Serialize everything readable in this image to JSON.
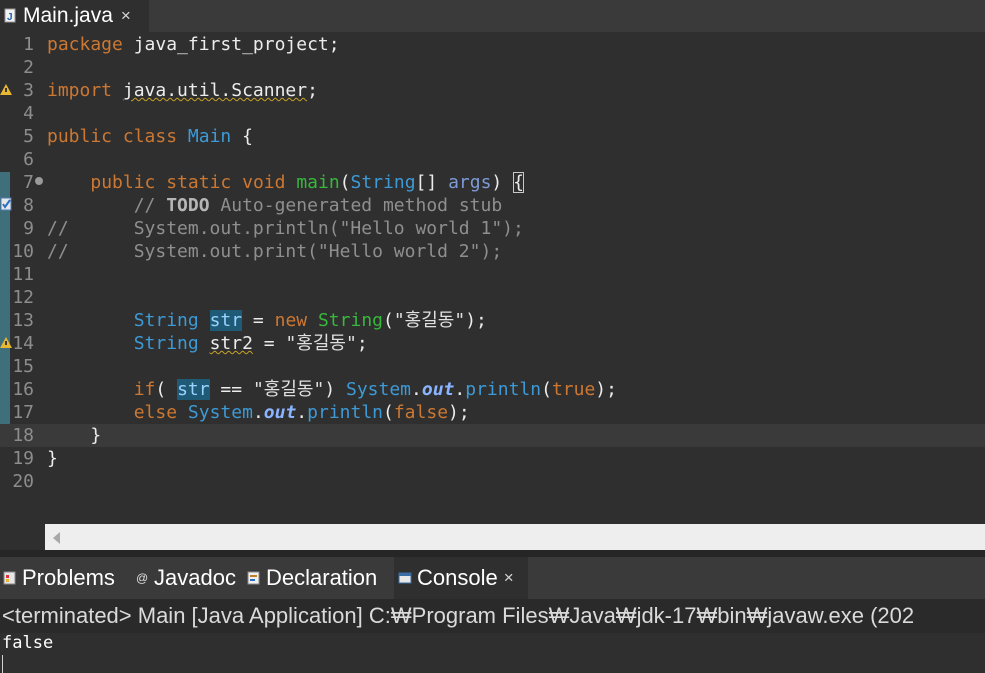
{
  "editor_tab": {
    "title": "Main.java",
    "close": "×",
    "icon": "java-file-icon"
  },
  "code_lines": [
    {
      "n": "1",
      "segments": [
        {
          "t": "package",
          "c": "kw"
        },
        {
          "t": " java_first_project;",
          "c": ""
        }
      ]
    },
    {
      "n": "2",
      "segments": []
    },
    {
      "n": "3",
      "segments": [
        {
          "t": "import",
          "c": "kw"
        },
        {
          "t": " ",
          "c": ""
        },
        {
          "t": "java.util.Scanner",
          "c": "warn-ul"
        },
        {
          "t": ";",
          "c": ""
        }
      ]
    },
    {
      "n": "4",
      "segments": []
    },
    {
      "n": "5",
      "segments": [
        {
          "t": "public",
          "c": "kw"
        },
        {
          "t": " ",
          "c": ""
        },
        {
          "t": "class",
          "c": "kw"
        },
        {
          "t": " ",
          "c": ""
        },
        {
          "t": "Main",
          "c": "typ"
        },
        {
          "t": " {",
          "c": ""
        }
      ]
    },
    {
      "n": "6",
      "segments": []
    },
    {
      "n": "7",
      "segments": [
        {
          "t": "    ",
          "c": ""
        },
        {
          "t": "public",
          "c": "kw"
        },
        {
          "t": " ",
          "c": ""
        },
        {
          "t": "static",
          "c": "kw"
        },
        {
          "t": " ",
          "c": ""
        },
        {
          "t": "void",
          "c": "kw"
        },
        {
          "t": " ",
          "c": ""
        },
        {
          "t": "main",
          "c": "fn"
        },
        {
          "t": "(",
          "c": ""
        },
        {
          "t": "String",
          "c": "typ"
        },
        {
          "t": "[] ",
          "c": ""
        },
        {
          "t": "args",
          "c": "param"
        },
        {
          "t": ") ",
          "c": ""
        },
        {
          "t": "{",
          "c": "brace-box"
        }
      ]
    },
    {
      "n": "8",
      "segments": [
        {
          "t": "        ",
          "c": ""
        },
        {
          "t": "// ",
          "c": "cmt"
        },
        {
          "t": "TODO",
          "c": "todo"
        },
        {
          "t": " Auto-generated method stub",
          "c": "cmt"
        }
      ]
    },
    {
      "n": "9",
      "segments": [
        {
          "t": "//      System.out.println(\"Hello world 1\");",
          "c": "cmt"
        }
      ]
    },
    {
      "n": "10",
      "segments": [
        {
          "t": "//      System.out.print(\"Hello world 2\");",
          "c": "cmt"
        }
      ]
    },
    {
      "n": "11",
      "segments": []
    },
    {
      "n": "12",
      "segments": []
    },
    {
      "n": "13",
      "segments": [
        {
          "t": "        ",
          "c": ""
        },
        {
          "t": "String",
          "c": "typ"
        },
        {
          "t": " ",
          "c": ""
        },
        {
          "t": "str",
          "c": "var-hl"
        },
        {
          "t": " = ",
          "c": ""
        },
        {
          "t": "new",
          "c": "kw"
        },
        {
          "t": " ",
          "c": ""
        },
        {
          "t": "String",
          "c": "fn"
        },
        {
          "t": "(",
          "c": ""
        },
        {
          "t": "\"홍길동\"",
          "c": "str"
        },
        {
          "t": ");",
          "c": ""
        }
      ]
    },
    {
      "n": "14",
      "segments": [
        {
          "t": "        ",
          "c": ""
        },
        {
          "t": "String",
          "c": "typ"
        },
        {
          "t": " ",
          "c": ""
        },
        {
          "t": "str2",
          "c": "warn-ul"
        },
        {
          "t": " = ",
          "c": ""
        },
        {
          "t": "\"홍길동\"",
          "c": "str"
        },
        {
          "t": ";",
          "c": ""
        }
      ]
    },
    {
      "n": "15",
      "segments": []
    },
    {
      "n": "16",
      "segments": [
        {
          "t": "        ",
          "c": ""
        },
        {
          "t": "if",
          "c": "kw"
        },
        {
          "t": "( ",
          "c": ""
        },
        {
          "t": "str",
          "c": "var-hl"
        },
        {
          "t": " == ",
          "c": ""
        },
        {
          "t": "\"홍길동\"",
          "c": "str"
        },
        {
          "t": ") ",
          "c": ""
        },
        {
          "t": "System",
          "c": "call"
        },
        {
          "t": ".",
          "c": ""
        },
        {
          "t": "out",
          "c": "field"
        },
        {
          "t": ".",
          "c": ""
        },
        {
          "t": "println",
          "c": "call"
        },
        {
          "t": "(",
          "c": ""
        },
        {
          "t": "true",
          "c": "kw"
        },
        {
          "t": ");",
          "c": ""
        }
      ]
    },
    {
      "n": "17",
      "segments": [
        {
          "t": "        ",
          "c": ""
        },
        {
          "t": "else",
          "c": "kw"
        },
        {
          "t": " ",
          "c": ""
        },
        {
          "t": "System",
          "c": "call"
        },
        {
          "t": ".",
          "c": ""
        },
        {
          "t": "out",
          "c": "field"
        },
        {
          "t": ".",
          "c": ""
        },
        {
          "t": "println",
          "c": "call"
        },
        {
          "t": "(",
          "c": ""
        },
        {
          "t": "false",
          "c": "kw"
        },
        {
          "t": ");",
          "c": ""
        }
      ]
    },
    {
      "n": "18",
      "segments": [
        {
          "t": "    }",
          "c": ""
        }
      ]
    },
    {
      "n": "19",
      "segments": [
        {
          "t": "}",
          "c": ""
        }
      ]
    },
    {
      "n": "20",
      "segments": []
    }
  ],
  "current_line": "18",
  "panel_tabs": [
    {
      "label": "Problems",
      "icon": "problems-icon"
    },
    {
      "label": "Javadoc",
      "icon": "javadoc-icon"
    },
    {
      "label": "Declaration",
      "icon": "declaration-icon"
    },
    {
      "label": "Console",
      "icon": "console-icon",
      "active": true,
      "close": "×"
    }
  ],
  "console": {
    "header": "<terminated> Main [Java Application] C:₩Program Files₩Java₩jdk-17₩bin₩javaw.exe  (202",
    "output": "false"
  }
}
